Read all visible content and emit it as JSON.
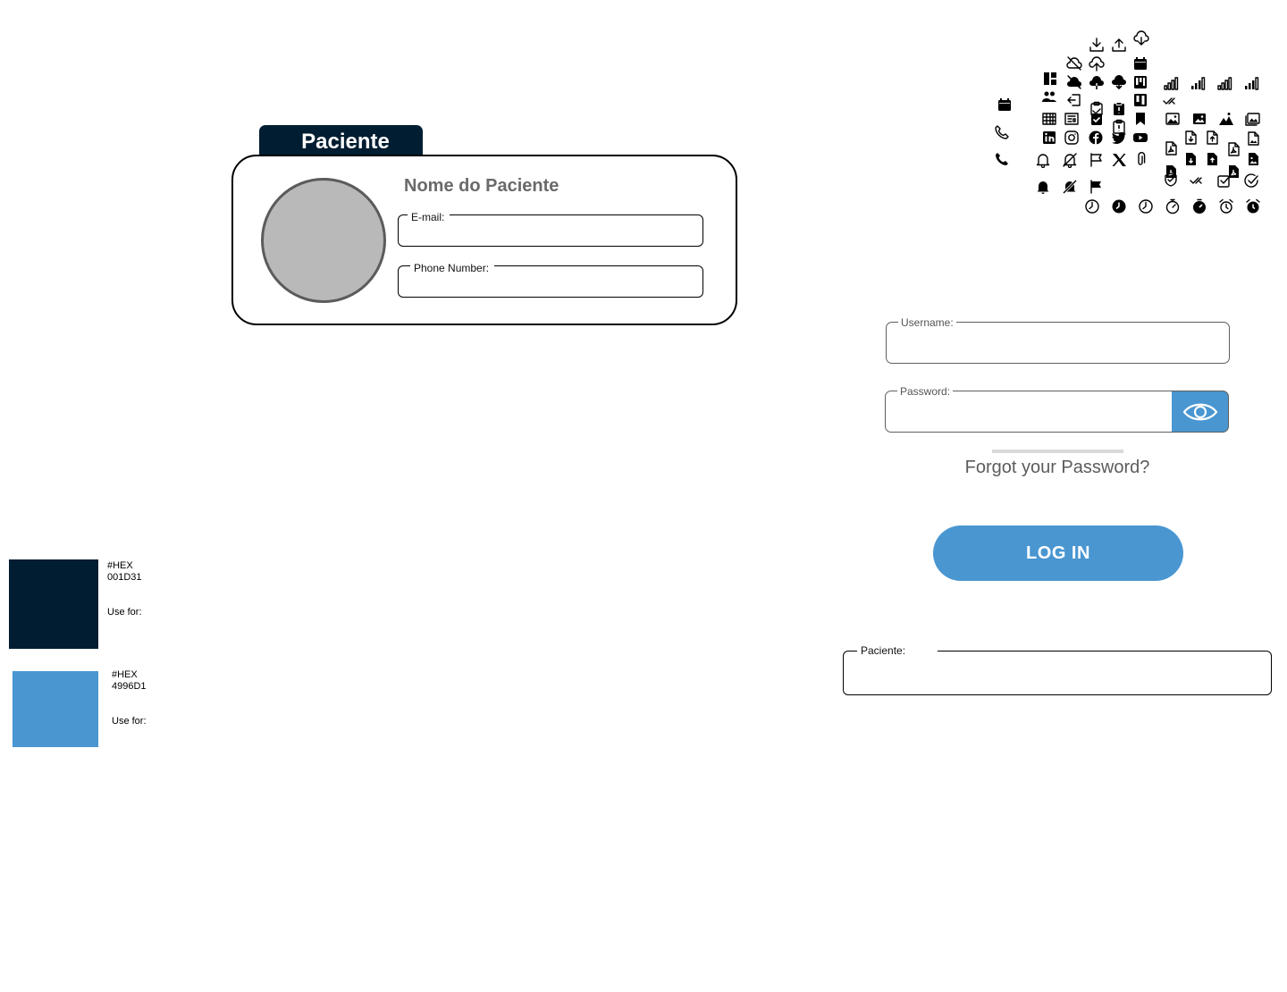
{
  "patient_card": {
    "tab_title": "Paciente",
    "name": "Nome do Paciente",
    "email_label": "E-mail:",
    "email_value": "",
    "phone_label": "Phone Number:",
    "phone_value": ""
  },
  "icons": [
    "download-icon",
    "upload-icon",
    "cloud-download-icon",
    "cloud-off-icon",
    "cloud-upload-icon",
    "calendar-icon",
    "dashboard-icon",
    "cloud-off-filled-icon",
    "cloud-upload-filled-icon",
    "cloud-download-filled-icon",
    "kanban-icon",
    "users-icon",
    "logout-icon",
    "clipboard-icon",
    "clipboard-filled-icon",
    "kanban-filled-icon",
    "calendar-icon",
    "table-icon",
    "news-icon",
    "clipboard-check-icon",
    "clipboard-alert-icon",
    "bookmark-icon",
    "phone-icon",
    "linkedin-icon",
    "instagram-icon",
    "facebook-icon",
    "twitter-icon",
    "youtube-icon",
    "phone-filled-icon",
    "bell-icon",
    "bell-off-icon",
    "flag-icon",
    "x-logo-icon",
    "paperclip-icon",
    "bell-filled-icon",
    "bell-off-filled-icon",
    "flag-filled-icon",
    "signal-weak-icon",
    "signal-strong-icon",
    "signal-weak-icon",
    "signal-strong-icon",
    "double-check-icon",
    "image-icon",
    "image-filled-icon",
    "landscape-icon",
    "gallery-icon",
    "file-pdf-icon",
    "file-download-icon",
    "file-upload-icon",
    "file-pdf-icon",
    "file-image-icon",
    "file-pdf-filled-icon",
    "file-download-filled-icon",
    "file-upload-filled-icon",
    "file-pdf-filled-icon",
    "file-image-filled-icon",
    "shield-check-icon",
    "double-check-icon",
    "checkbox-icon",
    "check-circle-icon",
    "clock-icon",
    "clock-filled-icon",
    "clock-icon",
    "timer-icon",
    "timer-filled-icon",
    "alarm-icon",
    "alarm-filled-icon"
  ],
  "login": {
    "username_label": "Username:",
    "username_value": "",
    "password_label": "Password:",
    "password_value": "",
    "forgot": "Forgot your Password?",
    "login_button": "LOG IN"
  },
  "patient_field": {
    "label": "Paciente:",
    "value": ""
  },
  "swatches": [
    {
      "hex_label": "#HEX",
      "hex": "001D31",
      "color": "#001D31",
      "use_label": "Use for:"
    },
    {
      "hex_label": "#HEX",
      "hex": "4996D1",
      "color": "#4996D1",
      "use_label": "Use for:"
    }
  ]
}
